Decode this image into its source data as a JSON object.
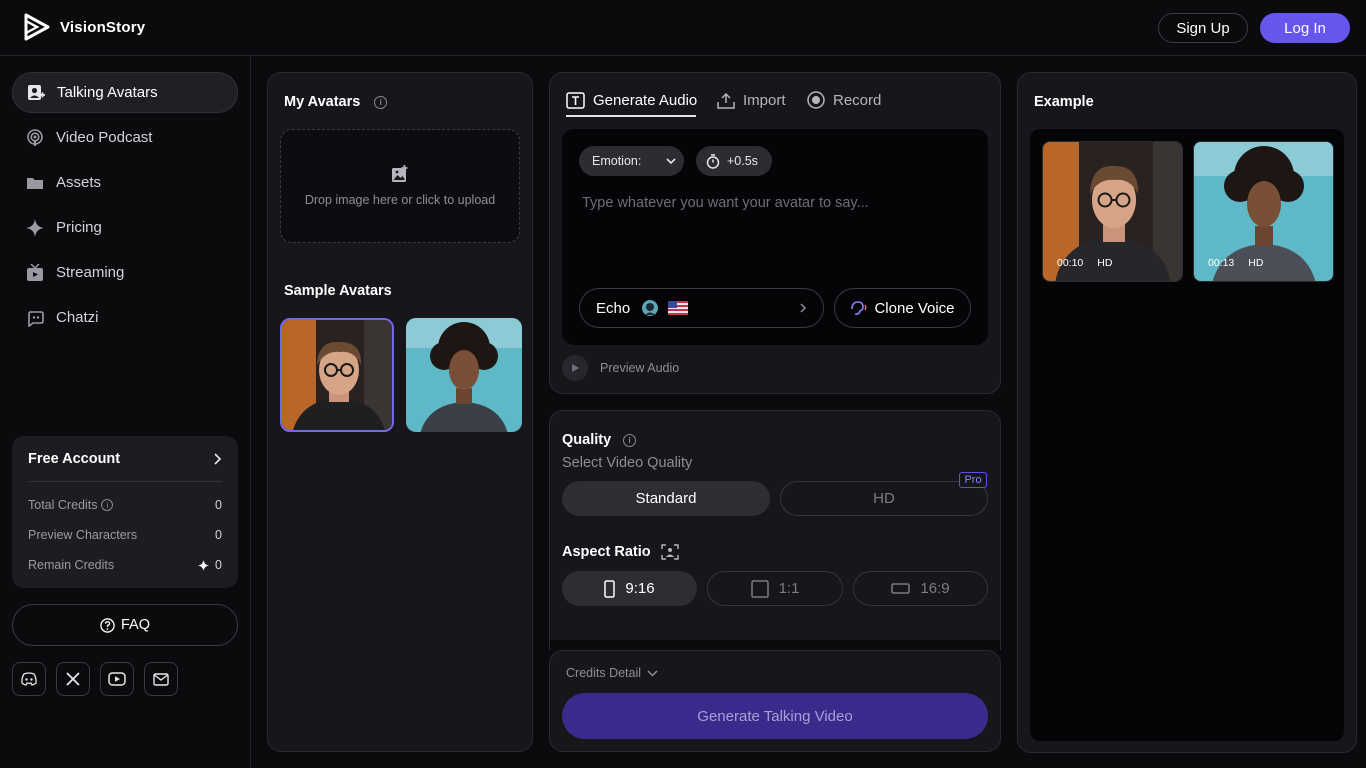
{
  "brand": {
    "name": "VisionStory",
    "logo_icon": "play-triangle-logo"
  },
  "header": {
    "signup_label": "Sign Up",
    "login_label": "Log In",
    "accent_color": "#6656ee"
  },
  "sidebar": {
    "items": [
      {
        "label": "Talking Avatars",
        "icon": "avatar-icon",
        "active": true
      },
      {
        "label": "Video Podcast",
        "icon": "podcast-icon",
        "active": false
      },
      {
        "label": "Assets",
        "icon": "folder-icon",
        "active": false
      },
      {
        "label": "Pricing",
        "icon": "sparkle-icon",
        "active": false
      },
      {
        "label": "Streaming",
        "icon": "tv-icon",
        "active": false
      },
      {
        "label": "Chatzi",
        "icon": "chat-bot-icon",
        "active": false
      }
    ],
    "account": {
      "title": "Free Account",
      "rows": [
        {
          "label": "Total Credits",
          "value": "0"
        },
        {
          "label": "Preview Characters",
          "value": "0"
        },
        {
          "label": "Remain Credits",
          "value": "0"
        }
      ]
    },
    "faq_label": "FAQ",
    "socials": [
      "discord-icon",
      "x-icon",
      "youtube-icon",
      "mail-icon"
    ]
  },
  "avatars": {
    "title": "My Avatars",
    "upload_text": "Drop image here or click to upload",
    "samples_title": "Sample Avatars"
  },
  "audio": {
    "tabs": [
      {
        "label": "Generate Audio",
        "icon": "text-box-icon",
        "active": true
      },
      {
        "label": "Import",
        "icon": "upload-icon",
        "active": false
      },
      {
        "label": "Record",
        "icon": "record-icon",
        "active": false
      }
    ],
    "emotion_label": "Emotion:",
    "pause_label": "+0.5s",
    "placeholder": "Type whatever you want your avatar to say...",
    "voice_name": "Echo",
    "clone_voice_label": "Clone Voice",
    "preview_label": "Preview Audio"
  },
  "settings": {
    "quality_title": "Quality",
    "quality_sub": "Select Video Quality",
    "quality_options": [
      "Standard",
      "HD"
    ],
    "quality_selected": "Standard",
    "pro_badge": "Pro",
    "aspect_title": "Aspect Ratio",
    "aspect_options": [
      "9:16",
      "1:1",
      "16:9"
    ],
    "aspect_selected": "9:16"
  },
  "generate": {
    "credits_detail_label": "Credits Detail",
    "button_label": "Generate Talking Video",
    "button_color": "#3b2a8c"
  },
  "example": {
    "title": "Example",
    "videos": [
      {
        "duration": "00:10",
        "quality": "HD"
      },
      {
        "duration": "00:13",
        "quality": "HD"
      }
    ]
  }
}
